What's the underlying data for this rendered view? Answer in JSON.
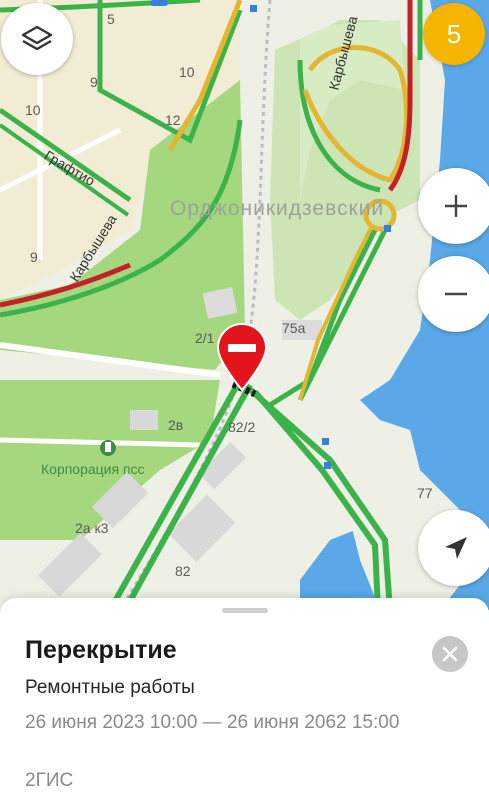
{
  "map": {
    "house_numbers": [
      "5",
      "10",
      "9",
      "10",
      "12",
      "9",
      "2/1",
      "75а",
      "2в",
      "82/2",
      "2а к3",
      "82",
      "77"
    ],
    "streets": [
      "Графтио",
      "Карбышева",
      "Карбышева"
    ],
    "district": "Орджоникидзевский",
    "poi": "Корпорация псс"
  },
  "controls": {
    "layers_icon": "layers-icon",
    "badge_count": "5",
    "zoom_in_icon": "plus-icon",
    "zoom_out_icon": "minus-icon",
    "locate_icon": "navigation-arrow-icon"
  },
  "marker": {
    "icon": "road-closed-icon",
    "color": "#e3141b"
  },
  "sheet": {
    "title": "Перекрытие",
    "subtitle": "Ремонтные работы",
    "dates": "26 июня 2023 10:00 — 26 июня 2062 15:00",
    "source": "2ГИС",
    "close_icon": "close-icon"
  },
  "colors": {
    "traffic_green": "#3cb34a",
    "traffic_yellow": "#e2b632",
    "traffic_red": "#c4202a",
    "water": "#5aa8e8",
    "park": "#9ed47a"
  }
}
